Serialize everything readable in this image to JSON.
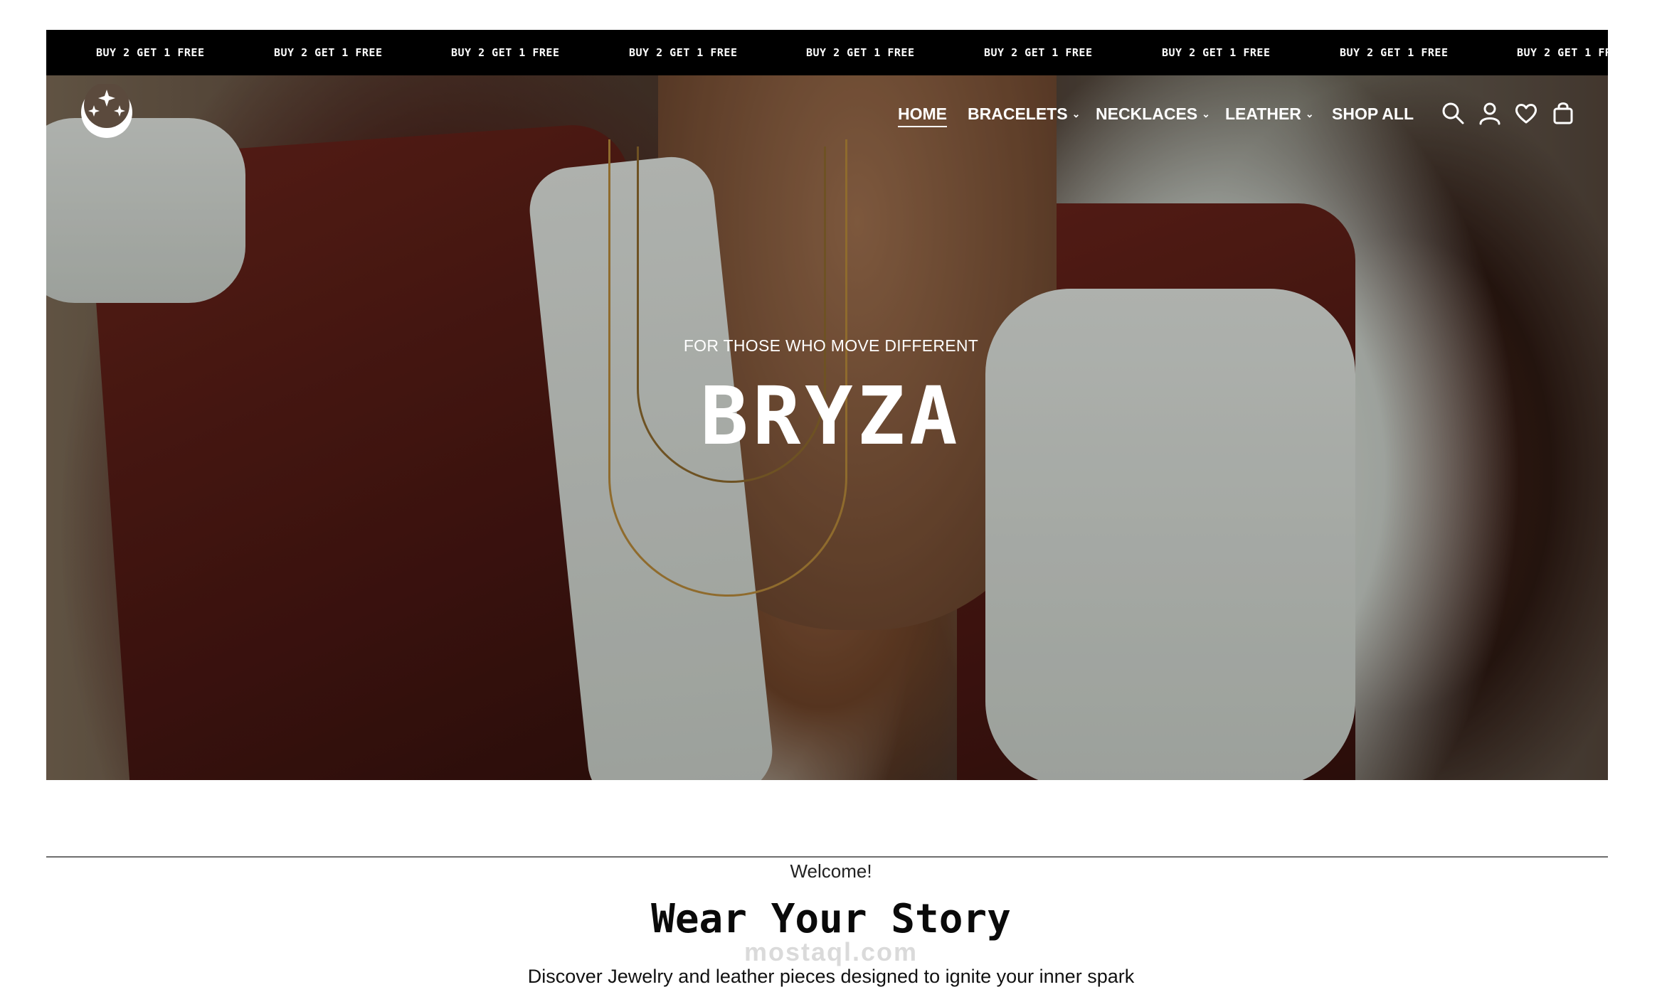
{
  "announcement": {
    "items": [
      "BUY 2 GET 1 FREE",
      "BUY 2 GET 1 FREE",
      "BUY 2 GET 1 FREE",
      "BUY 2 GET 1 FREE",
      "BUY 2 GET 1 FREE",
      "BUY 2 GET 1 FREE",
      "BUY 2 GET 1 FREE",
      "BUY 2 GET 1 FREE",
      "BUY 2 GET 1 FR"
    ]
  },
  "header": {
    "logo_icon": "moon-stars-logo",
    "nav": [
      {
        "label": "HOME",
        "active": true,
        "dropdown": false
      },
      {
        "label": "BRACELETS",
        "active": false,
        "dropdown": true
      },
      {
        "label": "NECKLACES",
        "active": false,
        "dropdown": true
      },
      {
        "label": "LEATHER",
        "active": false,
        "dropdown": true
      },
      {
        "label": "SHOP ALL",
        "active": false,
        "dropdown": false
      }
    ],
    "icons": [
      "search-icon",
      "account-icon",
      "wishlist-icon",
      "cart-icon"
    ]
  },
  "hero": {
    "tagline": "FOR THOSE WHO MOVE DIFFERENT",
    "title": "BRYZA"
  },
  "welcome": {
    "label": "Welcome!",
    "heading": "Wear Your Story",
    "subtext": "Discover Jewelry and leather pieces designed to ignite your inner spark",
    "watermark": "mostaql.com"
  },
  "colors": {
    "bar_background": "#000000",
    "text_light": "#ffffff",
    "text_dark": "#0a0a0a"
  }
}
